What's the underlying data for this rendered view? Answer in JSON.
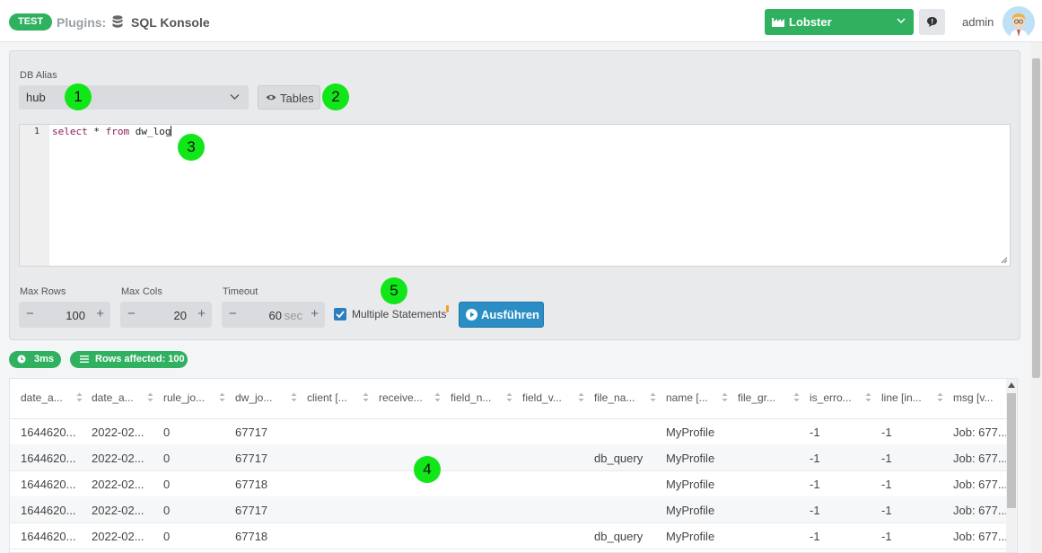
{
  "header": {
    "env_badge": "TEST",
    "crumb_prefix": "Plugins:",
    "crumb_title": "SQL Konsole",
    "workspace": "Lobster",
    "user_name": "admin"
  },
  "form": {
    "db_alias_label": "DB Alias",
    "db_alias_value": "hub",
    "tables_label": "Tables",
    "editor_line_number": "1",
    "query": {
      "kw1": "select",
      "mid": " * ",
      "kw2": "from",
      "rest": " dw_log"
    },
    "max_rows_label": "Max Rows",
    "max_rows_value": "100",
    "max_cols_label": "Max Cols",
    "max_cols_value": "20",
    "timeout_label": "Timeout",
    "timeout_value": "60",
    "timeout_unit": "sec",
    "multiple_statements_label": "Multiple Statements",
    "multiple_statements_checked": true,
    "run_label": "Ausführen",
    "stepper_minus": "−",
    "stepper_plus": "+"
  },
  "results": {
    "duration": "3ms",
    "rows_affected": "Rows affected: 100",
    "columns": [
      "date_a...",
      "date_a...",
      "rule_jo...",
      "dw_jo...",
      "client [...",
      "receive...",
      "field_n...",
      "field_v...",
      "file_na...",
      "name [...",
      "file_gr...",
      "is_erro...",
      "line [in...",
      "msg [v..."
    ],
    "rows": [
      [
        "1644620...",
        "2022-02...",
        "0",
        "67717",
        "",
        "",
        "",
        "",
        "",
        "MyProfile",
        "",
        "-1",
        "-1",
        "Job: 677..."
      ],
      [
        "1644620...",
        "2022-02...",
        "0",
        "67717",
        "",
        "",
        "",
        "",
        "db_query",
        "MyProfile",
        "",
        "-1",
        "-1",
        "Job: 677..."
      ],
      [
        "1644620...",
        "2022-02...",
        "0",
        "67718",
        "",
        "",
        "",
        "",
        "",
        "MyProfile",
        "",
        "-1",
        "-1",
        "Job: 677..."
      ],
      [
        "1644620...",
        "2022-02...",
        "0",
        "67717",
        "",
        "",
        "",
        "",
        "",
        "MyProfile",
        "",
        "-1",
        "-1",
        "Job: 677..."
      ],
      [
        "1644620...",
        "2022-02...",
        "0",
        "67718",
        "",
        "",
        "",
        "",
        "db_query",
        "MyProfile",
        "",
        "-1",
        "-1",
        "Job: 677..."
      ]
    ]
  },
  "markers": [
    "1",
    "2",
    "3",
    "4",
    "5"
  ],
  "colors": {
    "accent_green": "#2fb160",
    "run_button": "#2a8ec5",
    "marker_green": "#11e619"
  }
}
